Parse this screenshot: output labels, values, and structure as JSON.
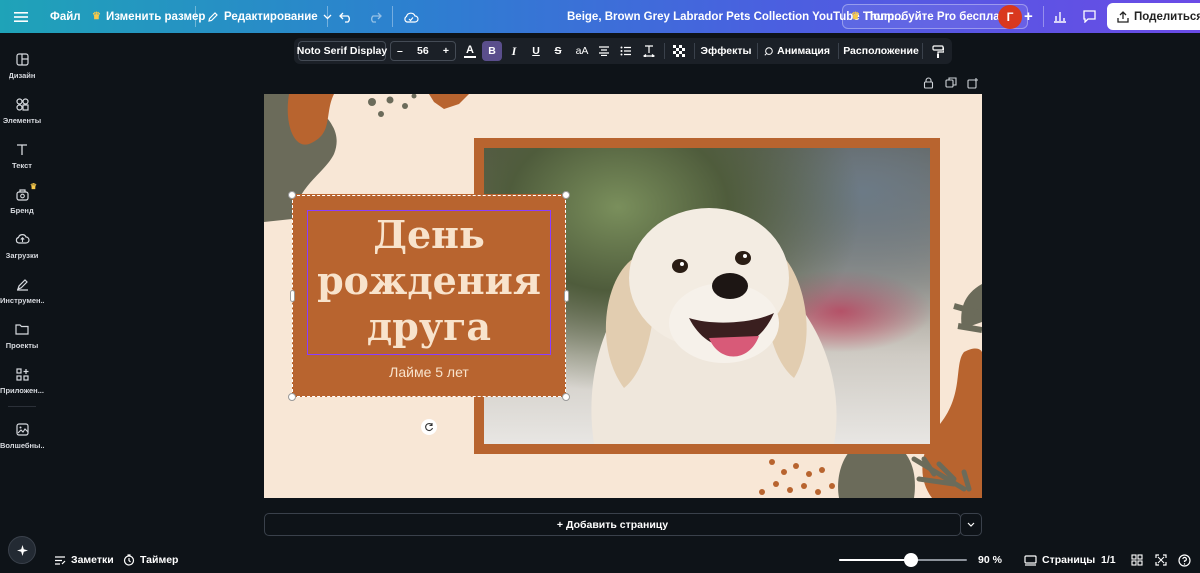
{
  "topbar": {
    "menu_icon": "hamburger-menu-icon",
    "file_label": "Файл",
    "resize_label": "Изменить размер",
    "editing_label": "Редактирование",
    "doc_title": "Beige, Brown Grey Labrador Pets Collection YouTube Thum...",
    "try_pro_label": "Попробуйте Pro бесплатно",
    "avatar_initial": "Г",
    "share_label": "Поделиться"
  },
  "format_toolbar": {
    "font_family": "Noto Serif Display",
    "minus": "–",
    "font_size": "56",
    "plus": "+",
    "bold": "B",
    "italic": "I",
    "underline": "U",
    "strike": "S",
    "case": "aA",
    "effects_label": "Эффекты",
    "animation_label": "Анимация",
    "position_label": "Расположение"
  },
  "sidebar": {
    "items": [
      {
        "label": "Дизайн",
        "icon": "layout-icon"
      },
      {
        "label": "Элементы",
        "icon": "shapes-icon"
      },
      {
        "label": "Текст",
        "icon": "text-icon"
      },
      {
        "label": "Бренд",
        "icon": "brand-icon"
      },
      {
        "label": "Загрузки",
        "icon": "cloud-upload-icon"
      },
      {
        "label": "Инструмен...",
        "icon": "pen-tool-icon"
      },
      {
        "label": "Проекты",
        "icon": "folder-icon"
      },
      {
        "label": "Приложен...",
        "icon": "apps-icon"
      },
      {
        "label": "Волшебны...",
        "icon": "magic-media-icon"
      }
    ]
  },
  "design": {
    "title_line1": "День",
    "title_line2": "рождения",
    "title_line3": "друга",
    "subtitle": "Лайме 5 лет"
  },
  "add_page_label": "+ Добавить страницу",
  "bottombar": {
    "notes_label": "Заметки",
    "timer_label": "Таймер",
    "zoom_percent": 90,
    "zoom_label": "90 %",
    "pages_label": "Страницы",
    "page_count": "1/1"
  },
  "colors": {
    "accent_brown": "#b8642f",
    "canvas_bg": "#f8e7d6",
    "olive": "#6b6b5a",
    "selection": "#8b3dff"
  }
}
